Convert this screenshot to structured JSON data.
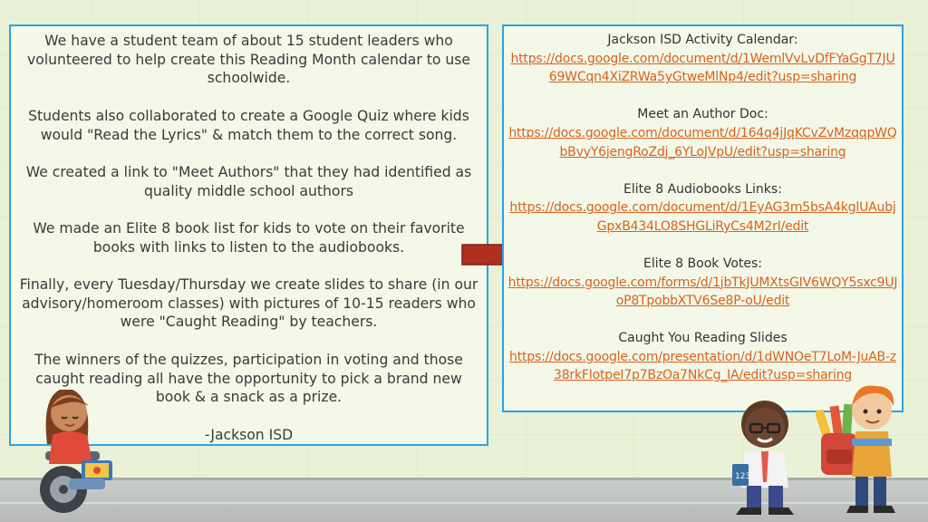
{
  "left_panel": {
    "paragraphs": [
      "We have a student team of about 15 student leaders who volunteered to help create this Reading Month calendar to use schoolwide.",
      "Students also collaborated to create a Google Quiz where kids would \"Read the Lyrics\" & match them to the correct song.",
      "We created a link to \"Meet Authors\" that they had identified as quality middle school authors",
      "We made an Elite 8 book list for kids to vote on their favorite books with links to listen to the audiobooks.",
      "Finally, every Tuesday/Thursday we create slides to share (in our advisory/homeroom classes) with pictures of 10-15 readers who were \"Caught Reading\" by teachers.",
      "The winners of the quizzes, participation in voting and those caught reading all have the opportunity to pick a brand new book & a snack as a prize.",
      "-Jackson ISD"
    ]
  },
  "right_panel": {
    "items": [
      {
        "label": "Jackson ISD Activity Calendar:",
        "url": "https://docs.google.com/document/d/1WemlVvLvDfFYaGgT7JU69WCqn4XiZRWa5yGtweMlNp4/edit?usp=sharing"
      },
      {
        "label": "Meet an Author Doc:",
        "url": "https://docs.google.com/document/d/164q4jJqKCvZvMzqqpWQbBvyY6jengRoZdj_6YLoJVpU/edit?usp=sharing"
      },
      {
        "label": "Elite 8 Audiobooks Links:",
        "url": "https://docs.google.com/document/d/1EyAG3m5bsA4kglUAubjGpxB434LO8SHGLiRyCs4M2rI/edit"
      },
      {
        "label": "Elite 8 Book Votes:",
        "url": "https://docs.google.com/forms/d/1jbTkJUMXtsGIV6WQY5sxc9UJoP8TpobbXTV6Se8P-oU/edit"
      },
      {
        "label": "Caught You Reading Slides",
        "url": "https://docs.google.com/presentation/d/1dWNOeT7LoM-JuAB-z38rkFIotpeI7p7BzOa7NkCg_IA/edit?usp=sharing"
      }
    ]
  },
  "colors": {
    "background": "#e9f1d6",
    "panel_border": "#2aa3e6",
    "link": "#d9621e",
    "arrow": "#b0301f"
  },
  "decorations": {
    "arrow_icon": "right-arrow-icon",
    "characters": [
      "girl-wheelchair-tablet",
      "boy-glasses-book",
      "boy-backpack-pencils"
    ]
  }
}
